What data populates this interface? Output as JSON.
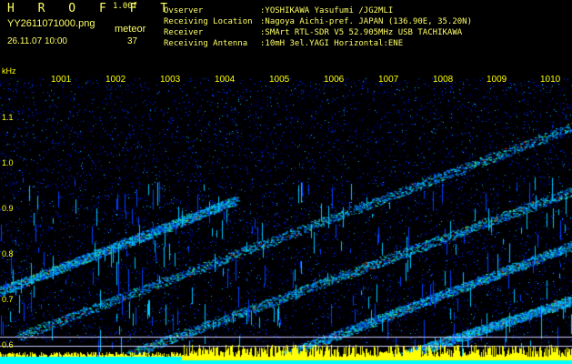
{
  "header": {
    "brand": "H R O F F T",
    "version": "1.00f",
    "filename": "YY2611071000.png",
    "mode_label": "meteor",
    "timestamp": "26.11.07 10:00",
    "meteor_count": "37",
    "info": [
      {
        "key": "Ovserver",
        "value": ":YOSHIKAWA Yasufumi /JG2MLI"
      },
      {
        "key": "Receiving Location",
        "value": ":Nagoya Aichi-pref. JAPAN (136.90E, 35.20N)"
      },
      {
        "key": "Receiver",
        "value": ":SMArt RTL-SDR V5 52.905MHz USB TACHIKAWA"
      },
      {
        "key": "Receiving Antenna",
        "value": ":10mH 3el.YAGI Horizontal:ENE"
      }
    ]
  },
  "spectrogram": {
    "unit_label": "kHz",
    "y_ticks": [
      "1.1",
      "1.0",
      "0.9",
      "0.8",
      "0.7",
      "0.6"
    ],
    "x_ticks": [
      "1001",
      "1002",
      "1003",
      "1004",
      "1005",
      "1006",
      "1007",
      "1008",
      "1009",
      "1010"
    ],
    "colors": {
      "background": "#000000",
      "noise_low": "#00008a",
      "noise_mid": "#0040ff",
      "trace_cyan": "#00c8ff",
      "trace_green": "#40ff80",
      "trace_red": "#ff4000",
      "baseline_yellow": "#ffff00",
      "baseline_cyan": "#00ffff",
      "marker_line": "#c8c8ff"
    }
  }
}
